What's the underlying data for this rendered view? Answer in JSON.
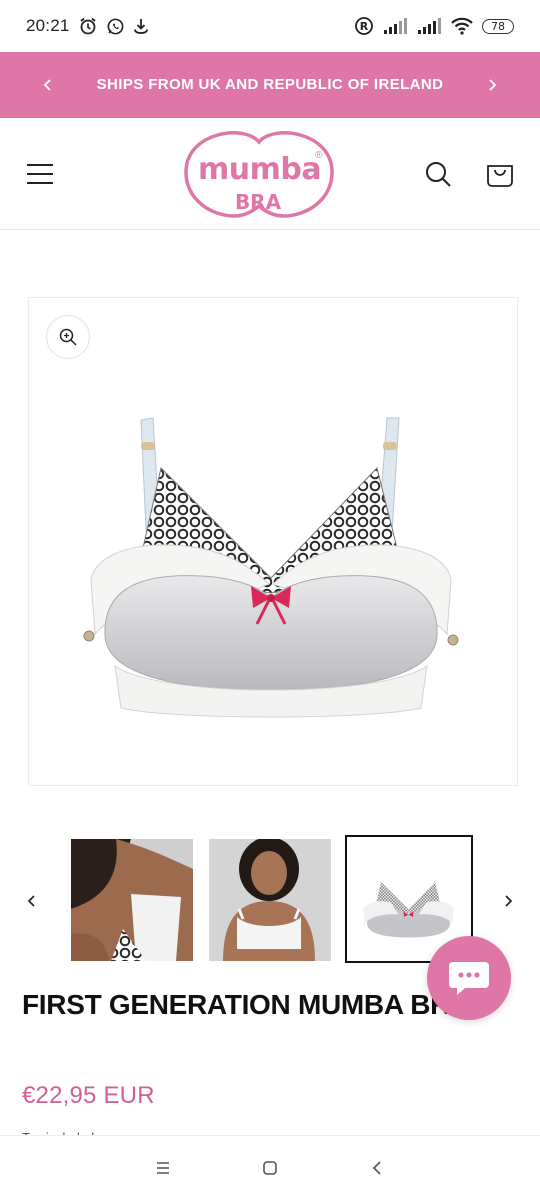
{
  "status_bar": {
    "time": "20:21",
    "battery": "78",
    "icons": [
      "alarm-icon",
      "whatsapp-icon",
      "download-icon",
      "registered-icon",
      "signal-icon",
      "signal-icon",
      "wifi-icon",
      "battery-icon"
    ]
  },
  "announcement": {
    "text": "SHIPS FROM UK AND REPUBLIC OF IRELAND",
    "background": "#de77a8"
  },
  "header": {
    "logo_text": "mumba",
    "logo_subtext": "BRA",
    "logo_mark": "®",
    "icons": [
      "menu-icon",
      "search-icon",
      "cart-icon"
    ]
  },
  "product": {
    "title": "FIRST GENERATION MUMBA BRA",
    "price": "€22,95 EUR",
    "tax_note": "Tax included."
  },
  "colors": {
    "accent": "#de77a8",
    "price": "#d05f96",
    "text": "#121212"
  }
}
